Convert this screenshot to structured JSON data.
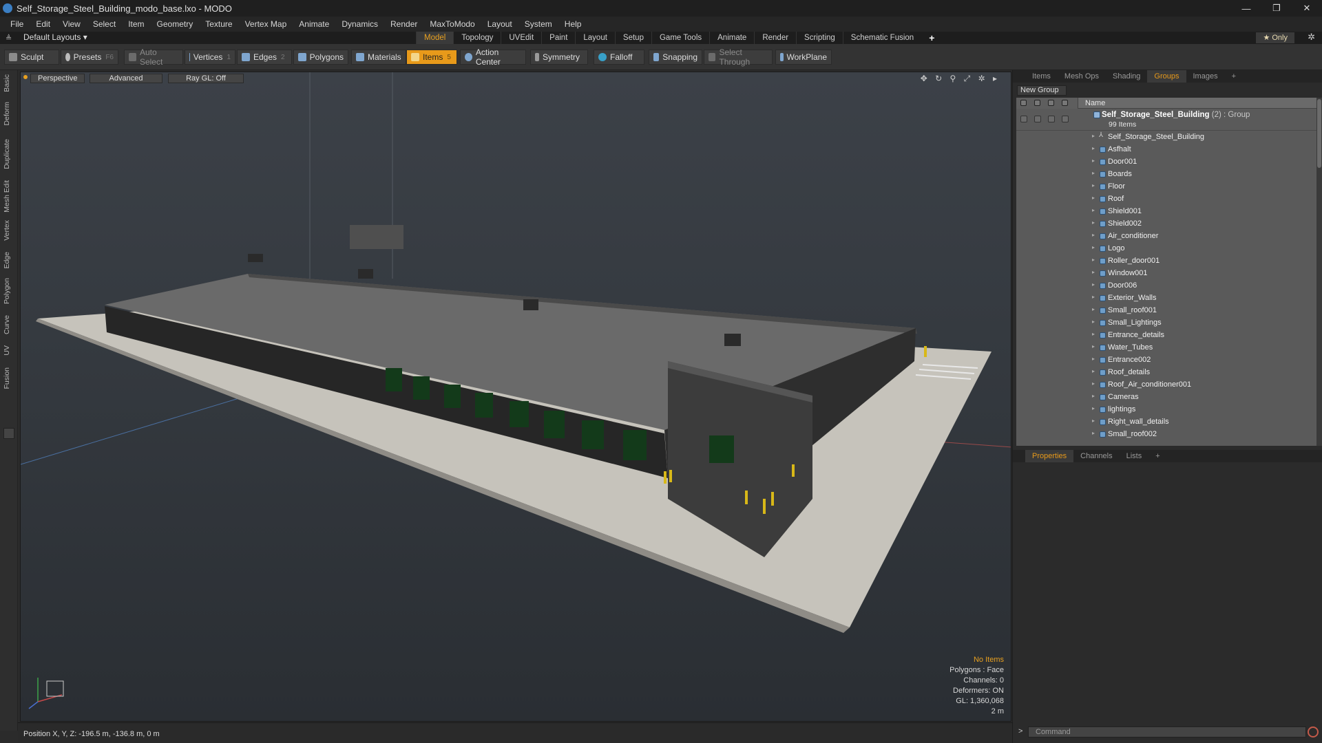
{
  "titlebar": {
    "title": "Self_Storage_Steel_Building_modo_base.lxo - MODO",
    "min": "—",
    "max": "❐",
    "close": "✕"
  },
  "menu": [
    "File",
    "Edit",
    "View",
    "Select",
    "Item",
    "Geometry",
    "Texture",
    "Vertex Map",
    "Animate",
    "Dynamics",
    "Render",
    "MaxToModo",
    "Layout",
    "System",
    "Help"
  ],
  "modebar": {
    "layouts": "Default Layouts ▾",
    "tabs": [
      "Model",
      "Topology",
      "UVEdit",
      "Paint",
      "Layout",
      "Setup",
      "Game Tools",
      "Animate",
      "Render",
      "Scripting",
      "Schematic Fusion"
    ],
    "active_tab": "Model",
    "plus": "+",
    "only": "★  Only",
    "gear": "✲"
  },
  "toolbar": {
    "sculpt": "Sculpt",
    "presets": "Presets",
    "presets_key": "F6",
    "auto_select": "Auto Select",
    "vertices": "Vertices",
    "vertices_key": "1",
    "edges": "Edges",
    "edges_key": "2",
    "polygons": "Polygons",
    "materials": "Materials",
    "items": "Items",
    "items_key": "5",
    "action_center": "Action Center",
    "symmetry": "Symmetry",
    "falloff": "Falloff",
    "snapping": "Snapping",
    "select_through": "Select Through",
    "workplane": "WorkPlane"
  },
  "left_tabs": [
    "Basic",
    "Deform",
    "Duplicate",
    "Mesh Edit",
    "Vertex",
    "Edge",
    "Polygon",
    "Curve",
    "UV",
    "Fusion"
  ],
  "viewport": {
    "perspective": "Perspective",
    "advanced": "Advanced",
    "raygl": "Ray GL: Off",
    "icons": "✥ ↻ ⚲ ⤢ ✲ ▸",
    "stats": {
      "no_items": "No Items",
      "polygons": "Polygons : Face",
      "channels": "Channels: 0",
      "deformers": "Deformers: ON",
      "gl": "GL: 1,360,068",
      "scale": "2 m"
    }
  },
  "status": {
    "position": "Position X, Y, Z:  -196.5 m, -136.8 m, 0 m"
  },
  "right_panel": {
    "top_tabs": [
      "Items",
      "Mesh Ops",
      "Shading",
      "Groups",
      "Images",
      "+"
    ],
    "active_top": "Groups",
    "new_group": "New Group",
    "name_header": "Name",
    "group": {
      "name": "Self_Storage_Steel_Building",
      "count": " (2)",
      "type": " : Group",
      "items": "99 Items"
    },
    "rows": [
      "Self_Storage_Steel_Building",
      "Asfhalt",
      "Door001",
      "Boards",
      "Floor",
      "Roof",
      "Shield001",
      "Shield002",
      "Air_conditioner",
      "Logo",
      "Roller_door001",
      "Window001",
      "Door006",
      "Exterior_Walls",
      "Small_roof001",
      "Small_Lightings",
      "Entrance_details",
      "Water_Tubes",
      "Entrance002",
      "Roof_details",
      "Roof_Air_conditioner001",
      "Cameras",
      "lightings",
      "Right_wall_details",
      "Small_roof002"
    ],
    "bottom_tabs": [
      "Properties",
      "Channels",
      "Lists",
      "+"
    ],
    "active_bottom": "Properties",
    "command_placeholder": "Command",
    "command_arrow": ">"
  }
}
